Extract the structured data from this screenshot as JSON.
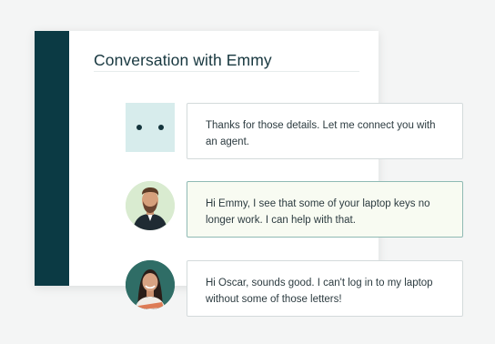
{
  "conversation": {
    "title": "Conversation with Emmy"
  },
  "messages": [
    {
      "sender": "bot",
      "avatar_icon": "chatbot-face-icon",
      "text": "Thanks for those details. Let me connect you with an agent."
    },
    {
      "sender": "agent",
      "avatar_icon": "agent-avatar",
      "text": "Hi Emmy, I see that some of your laptop keys no longer work. I can help with that."
    },
    {
      "sender": "customer",
      "avatar_icon": "customer-avatar",
      "text": "Hi Oscar, sounds good. I can't log in to my laptop without some of those letters!"
    }
  ],
  "colors": {
    "sidebar": "#0b3a44",
    "bot_avatar": "#d7ecec",
    "highlight_border": "#8fbab4",
    "highlight_fill": "#f8fbf2"
  }
}
